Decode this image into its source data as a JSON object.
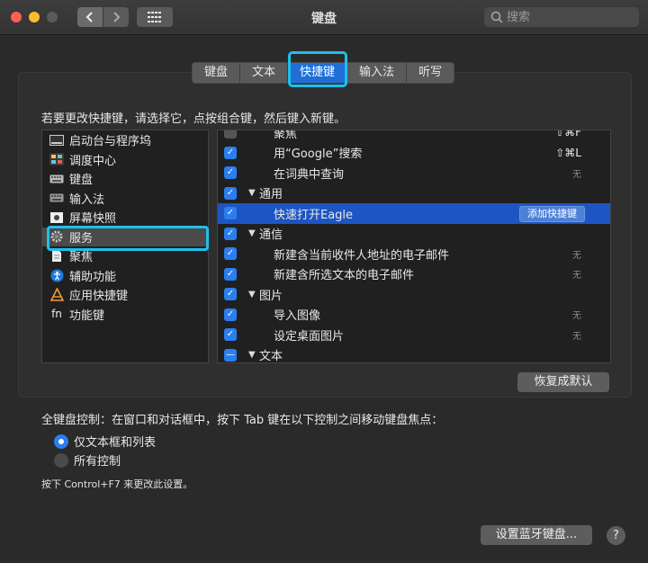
{
  "window": {
    "title": "键盘"
  },
  "search": {
    "placeholder": "搜索"
  },
  "tabs": [
    {
      "label": "键盘",
      "active": false
    },
    {
      "label": "文本",
      "active": false
    },
    {
      "label": "快捷键",
      "active": true
    },
    {
      "label": "输入法",
      "active": false
    },
    {
      "label": "听写",
      "active": false
    }
  ],
  "instruction": "若要更改快捷键，请选择它，点按组合键，然后键入新键。",
  "sidebar": {
    "items": [
      {
        "label": "启动台与程序坞",
        "icon": "launchpad-dock-icon",
        "selected": false
      },
      {
        "label": "调度中心",
        "icon": "mission-control-icon",
        "selected": false
      },
      {
        "label": "键盘",
        "icon": "keyboard-icon",
        "selected": false
      },
      {
        "label": "输入法",
        "icon": "input-method-icon",
        "selected": false
      },
      {
        "label": "屏幕快照",
        "icon": "screenshot-icon",
        "selected": false
      },
      {
        "label": "服务",
        "icon": "gear-icon",
        "selected": true
      },
      {
        "label": "聚焦",
        "icon": "spotlight-doc-icon",
        "selected": false
      },
      {
        "label": "辅助功能",
        "icon": "accessibility-icon",
        "selected": false
      },
      {
        "label": "应用快捷键",
        "icon": "app-shortcuts-icon",
        "selected": false
      },
      {
        "label": "功能键",
        "icon": "fn-key-icon",
        "selected": false
      }
    ]
  },
  "shortcuts": {
    "rows": [
      {
        "type": "item",
        "label": "聚焦",
        "checked": false,
        "key": "⇧⌘F"
      },
      {
        "type": "item",
        "label": "用“Google”搜索",
        "checked": true,
        "key": "⇧⌘L"
      },
      {
        "type": "item",
        "label": "在词典中查询",
        "checked": true,
        "key": "无"
      },
      {
        "type": "category",
        "label": "通用",
        "checked": true
      },
      {
        "type": "item",
        "label": "快速打开Eagle",
        "checked": true,
        "key": "",
        "selected": true,
        "action": "添加快捷键"
      },
      {
        "type": "category",
        "label": "通信",
        "checked": true
      },
      {
        "type": "item",
        "label": "新建含当前收件人地址的电子邮件",
        "checked": true,
        "key": "无"
      },
      {
        "type": "item",
        "label": "新建含所选文本的电子邮件",
        "checked": true,
        "key": "无"
      },
      {
        "type": "category",
        "label": "图片",
        "checked": true
      },
      {
        "type": "item",
        "label": "导入图像",
        "checked": true,
        "key": "无"
      },
      {
        "type": "item",
        "label": "设定桌面图片",
        "checked": true,
        "key": "无"
      },
      {
        "type": "category",
        "label": "文本",
        "checked": "mixed"
      }
    ]
  },
  "restore_button": "恢复成默认",
  "full_keyboard": {
    "label": "全键盘控制：在窗口和对话框中，按下 Tab 键在以下控制之间移动键盘焦点：",
    "options": [
      {
        "label": "仅文本框和列表",
        "selected": true
      },
      {
        "label": "所有控制",
        "selected": false
      }
    ],
    "hint": "按下 Control+F7 来更改此设置。"
  },
  "bluetooth_button": "设置蓝牙键盘...",
  "help_button": "?"
}
